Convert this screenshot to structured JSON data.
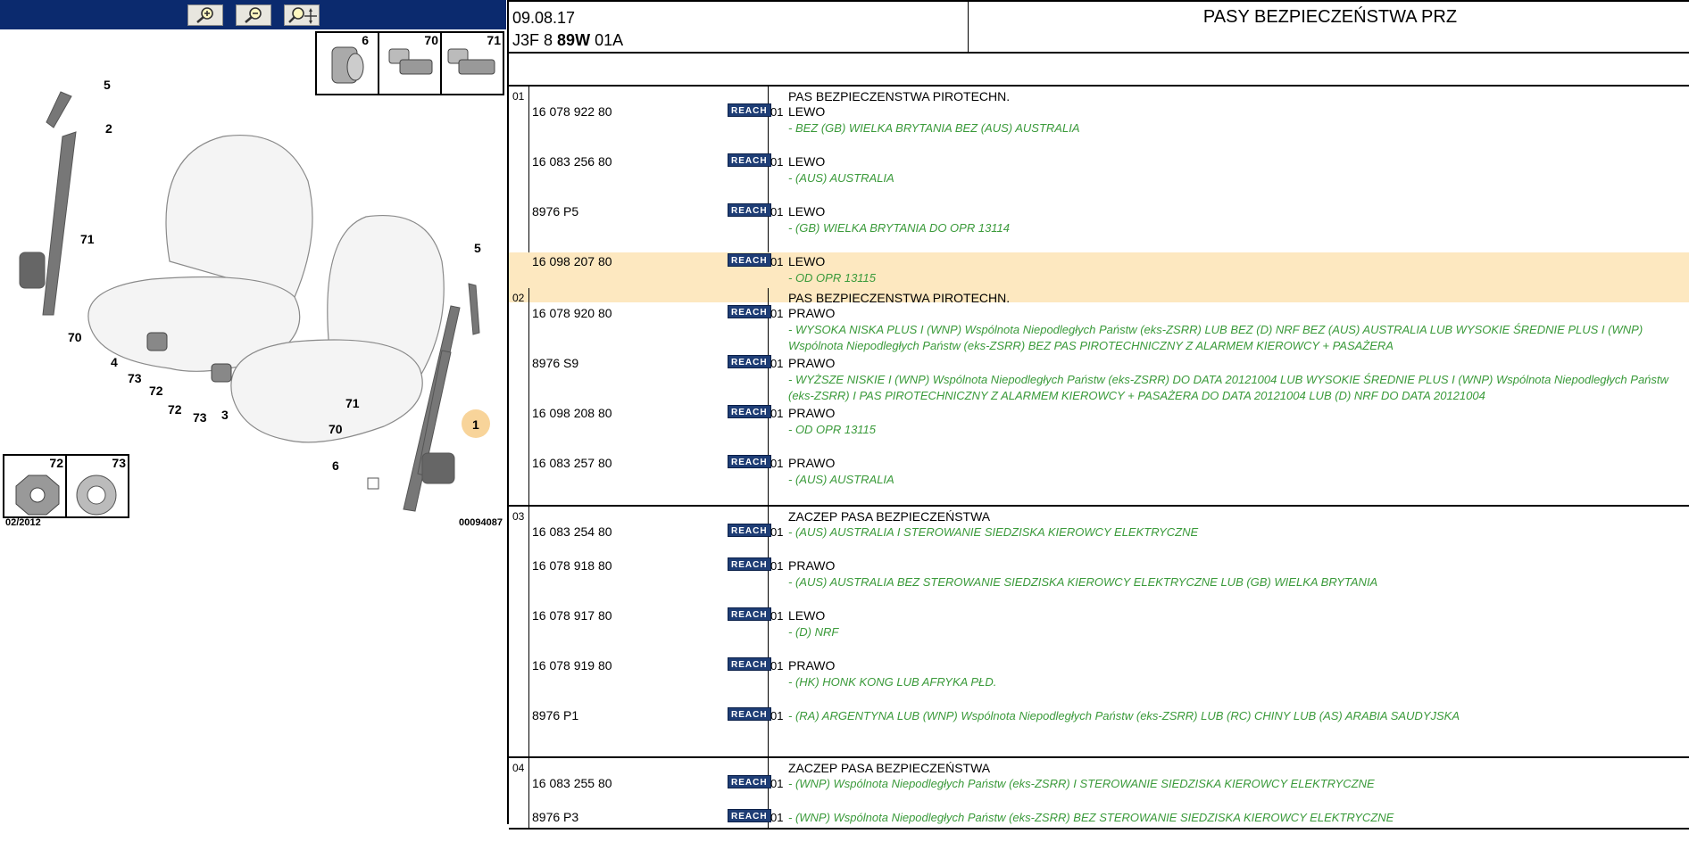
{
  "toolbar": {
    "zoom_in": "zoom-in-icon",
    "zoom_out": "zoom-out-icon",
    "pan": "pan-icon"
  },
  "header": {
    "date": "09.08.17",
    "code_prefix": "J3F 8",
    "code_bold": "89W",
    "code_suffix": "01A",
    "title": "PASY BEZPIECZEŃSTWA PRZ"
  },
  "diagram": {
    "date_label": "02/2012",
    "ref_number": "00094087",
    "inset_parts": [
      "6",
      "70",
      "71"
    ],
    "inset_parts2": [
      "72",
      "73"
    ],
    "callouts": [
      "5",
      "2",
      "71",
      "70",
      "4",
      "73",
      "72",
      "72",
      "73",
      "3",
      "5",
      "1",
      "71",
      "70",
      "6"
    ]
  },
  "groups": [
    {
      "num": "01",
      "title": "PAS BEZPIECZENSTWA PIROTECHN.",
      "rows": [
        {
          "pn": "16 078 922 80",
          "reach": "REACH",
          "qty": "01",
          "side": "LEWO",
          "desc": "- BEZ (GB) WIELKA BRYTANIA BEZ (AUS) AUSTRALIA"
        },
        {
          "pn": "16 083 256 80",
          "reach": "REACH",
          "qty": "01",
          "side": "LEWO",
          "desc": "- (AUS) AUSTRALIA"
        },
        {
          "pn": "8976 P5",
          "reach": "REACH",
          "qty": "01",
          "side": "LEWO",
          "desc": "- (GB) WIELKA BRYTANIA DO OPR 13114"
        },
        {
          "pn": "16 098 207 80",
          "reach": "REACH",
          "qty": "01",
          "side": "LEWO",
          "desc": "- OD OPR 13115",
          "highlight": true
        }
      ]
    },
    {
      "num": "02",
      "title": "PAS BEZPIECZENSTWA PIROTECHN.",
      "rows": [
        {
          "pn": "16 078 920 80",
          "reach": "REACH",
          "qty": "01",
          "side": "PRAWO",
          "desc": "- WYSOKA NISKA PLUS I (WNP) Wspólnota Niepodległych Państw (eks-ZSRR) LUB BEZ (D) NRF BEZ (AUS) AUSTRALIA LUB WYSOKIE ŚREDNIE PLUS I (WNP) Wspólnota Niepodległych Państw (eks-ZSRR) BEZ PAS PIROTECHNICZNY Z ALARMEM KIEROWCY + PASAŻERA"
        },
        {
          "pn": "8976 S9",
          "reach": "REACH",
          "qty": "01",
          "side": "PRAWO",
          "desc": "- WYŻSZE NISKIE I (WNP) Wspólnota Niepodległych Państw (eks-ZSRR) DO DATA 20121004 LUB WYSOKIE ŚREDNIE PLUS I (WNP) Wspólnota Niepodległych Państw (eks-ZSRR) I PAS PIROTECHNICZNY Z ALARMEM KIEROWCY + PASAŻERA DO DATA 20121004 LUB (D) NRF DO DATA 20121004"
        },
        {
          "pn": "16 098 208 80",
          "reach": "REACH",
          "qty": "01",
          "side": "PRAWO",
          "desc": "- OD OPR 13115"
        },
        {
          "pn": "16 083 257 80",
          "reach": "REACH",
          "qty": "01",
          "side": "PRAWO",
          "desc": "- (AUS) AUSTRALIA"
        }
      ]
    },
    {
      "num": "03",
      "title": "ZACZEP PASA BEZPIECZEŃSTWA",
      "rows": [
        {
          "pn": "16 083 254 80",
          "reach": "REACH",
          "qty": "01",
          "side": "",
          "desc": "- (AUS) AUSTRALIA I STEROWANIE SIEDZISKA KIEROWCY ELEKTRYCZNE"
        },
        {
          "pn": "16 078 918 80",
          "reach": "REACH",
          "qty": "01",
          "side": "PRAWO",
          "desc": "- (AUS) AUSTRALIA BEZ STEROWANIE SIEDZISKA KIEROWCY ELEKTRYCZNE LUB (GB) WIELKA BRYTANIA"
        },
        {
          "pn": "16 078 917 80",
          "reach": "REACH",
          "qty": "01",
          "side": "LEWO",
          "desc": "- (D) NRF"
        },
        {
          "pn": "16 078 919 80",
          "reach": "REACH",
          "qty": "01",
          "side": "PRAWO",
          "desc": "- (HK) HONK KONG LUB AFRYKA PŁD."
        },
        {
          "pn": "8976 P1",
          "reach": "REACH",
          "qty": "01",
          "side": "",
          "desc": "- (RA) ARGENTYNA LUB (WNP) Wspólnota Niepodległych Państw (eks-ZSRR) LUB (RC) CHINY LUB (AS) ARABIA SAUDYJSKA"
        }
      ]
    },
    {
      "num": "04",
      "title": "ZACZEP PASA BEZPIECZEŃSTWA",
      "rows": [
        {
          "pn": "16 083 255 80",
          "reach": "REACH",
          "qty": "01",
          "side": "",
          "desc": "- (WNP) Wspólnota Niepodległych Państw (eks-ZSRR) I STEROWANIE SIEDZISKA KIEROWCY ELEKTRYCZNE"
        },
        {
          "pn": "8976 P3",
          "reach": "REACH",
          "qty": "01",
          "side": "",
          "desc": "- (WNP) Wspólnota Niepodległych Państw (eks-ZSRR) BEZ STEROWANIE SIEDZISKA KIEROWCY ELEKTRYCZNE"
        }
      ]
    }
  ]
}
